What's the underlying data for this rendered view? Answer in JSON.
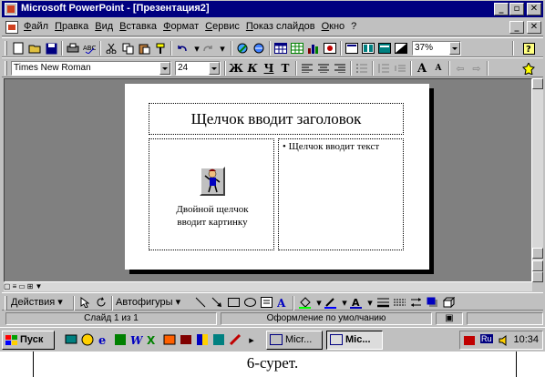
{
  "window": {
    "title": "Microsoft PowerPoint - [Презентация2]",
    "minimize": "_",
    "maximize": "▫",
    "close": "✕"
  },
  "menu": {
    "items": [
      "Файл",
      "Правка",
      "Вид",
      "Вставка",
      "Формат",
      "Сервис",
      "Показ слайдов",
      "Окно",
      "?"
    ]
  },
  "standard_toolbar": {
    "zoom": "37%"
  },
  "formatting_toolbar": {
    "font_name": "Times New Roman",
    "font_size": "24",
    "bold": "Ж",
    "italic": "К",
    "underline": "Ч",
    "shadow": "Т"
  },
  "slide": {
    "title_placeholder": "Щелчок вводит заголовок",
    "text_placeholder": "Щелчок вводит текст",
    "clipart_caption_line1": "Двойной щелчок",
    "clipart_caption_line2": "вводит картинку"
  },
  "drawing_toolbar": {
    "actions": "Действия",
    "autoshapes": "Автофигуры"
  },
  "statusbar": {
    "slide_info": "Слайд 1 из 1",
    "design": "Оформление по умолчанию"
  },
  "taskbar": {
    "start": "Пуск",
    "task_word": "Micr...",
    "task_ppt": "Mic...",
    "lang": "Ru",
    "clock": "10:34"
  },
  "caption": "6-сурет.",
  "colors": {
    "titlebar": "#000080",
    "face": "#c0c0c0",
    "workspace": "#808080"
  }
}
